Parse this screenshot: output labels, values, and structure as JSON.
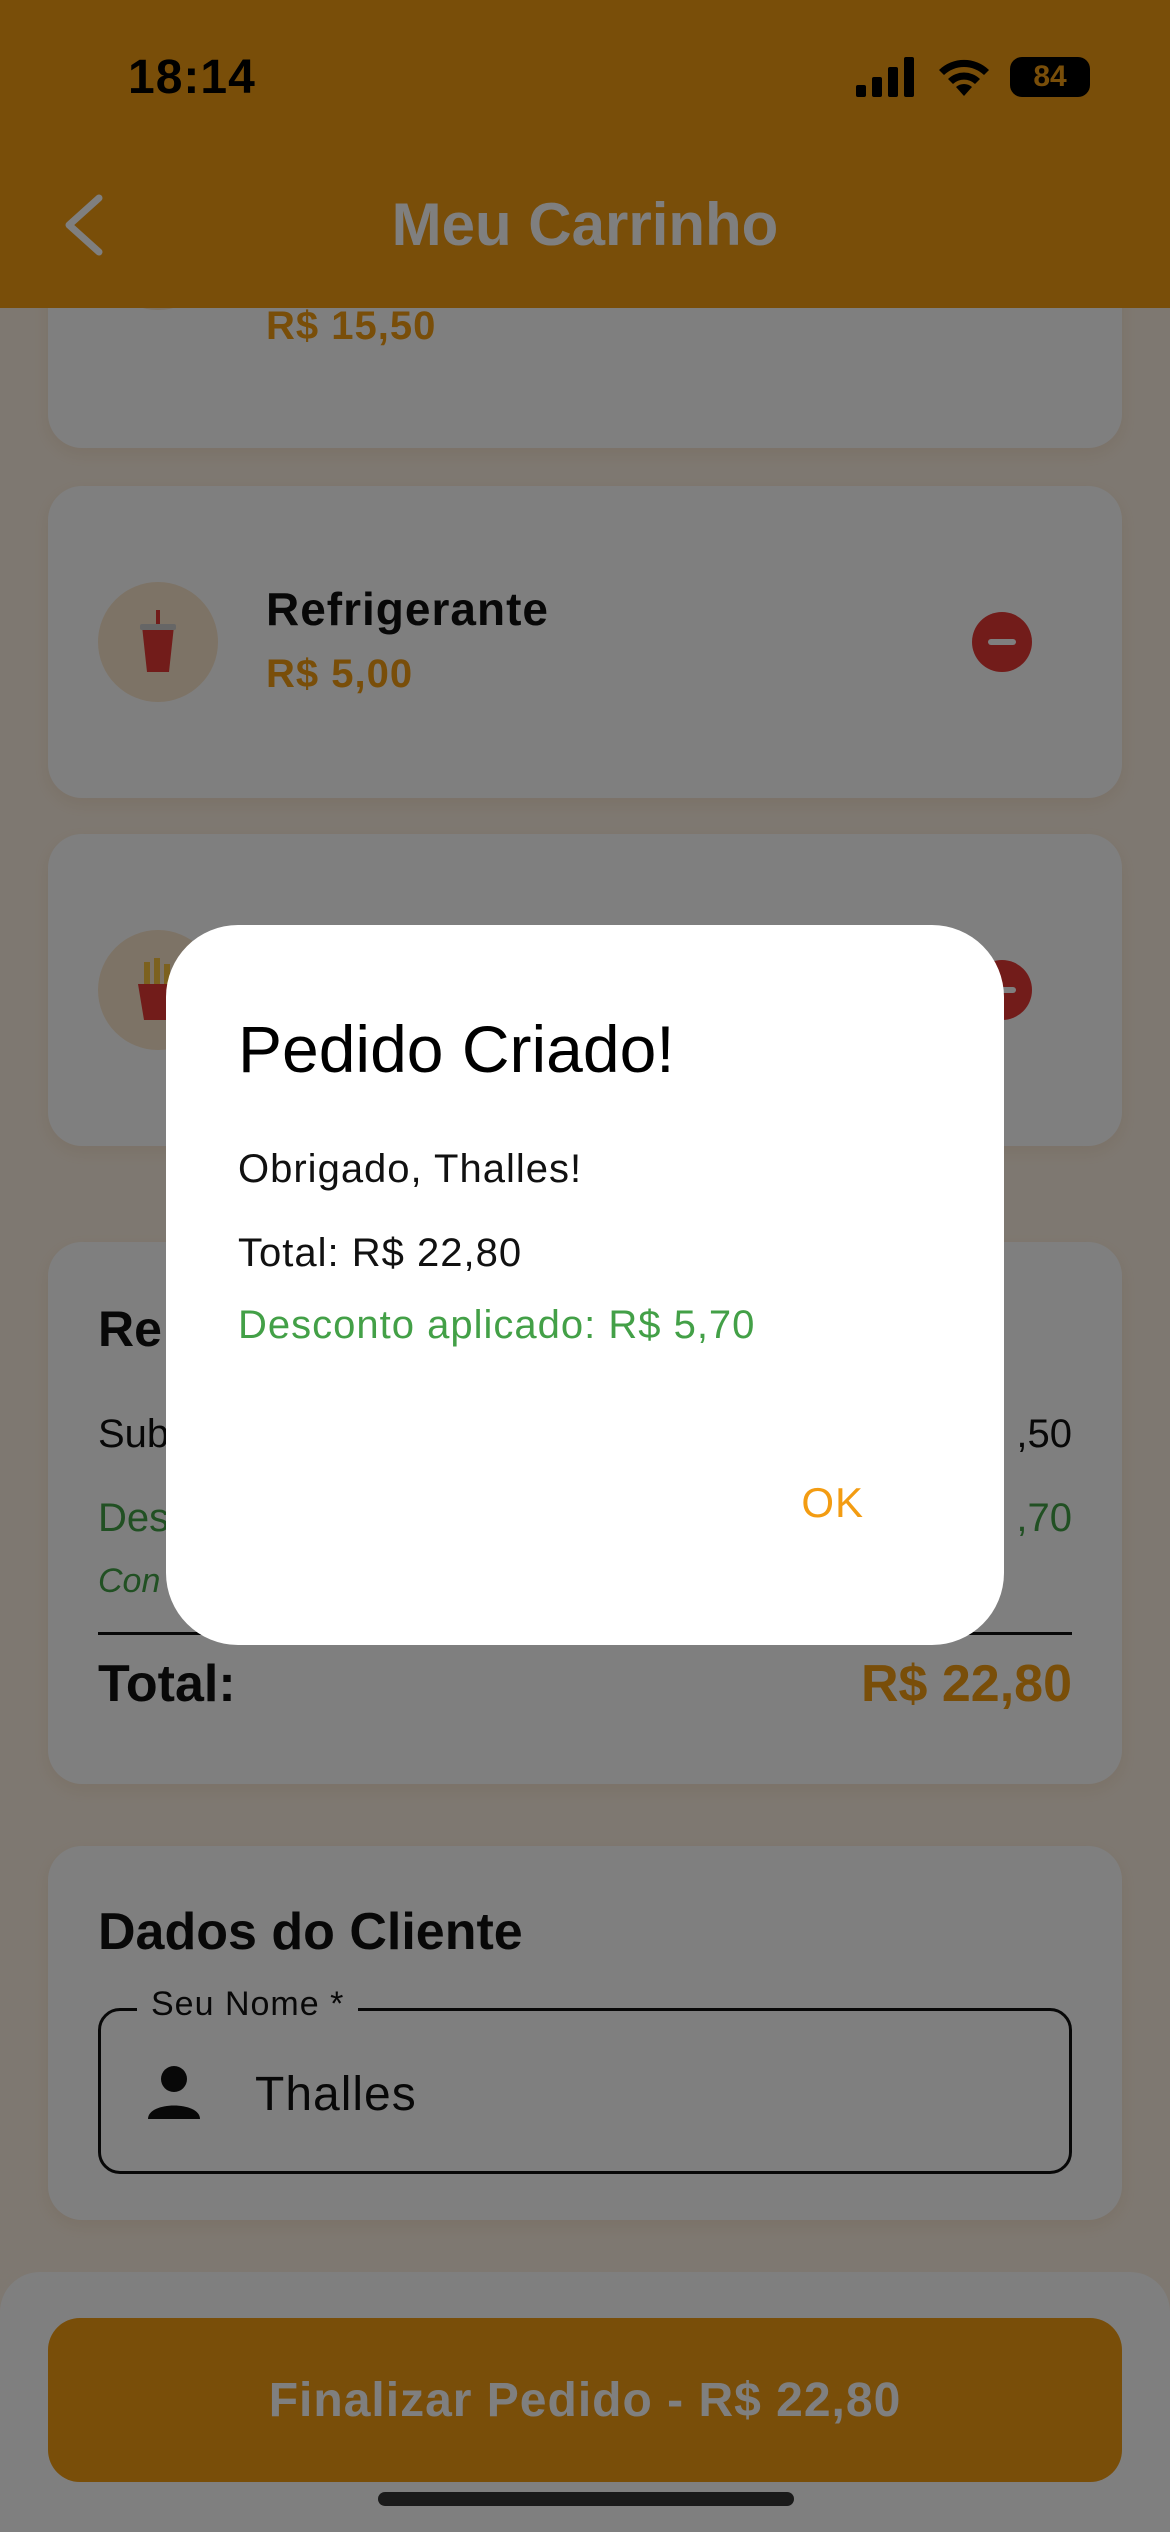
{
  "status_bar": {
    "time": "18:14",
    "battery": "84"
  },
  "header": {
    "title": "Meu Carrinho"
  },
  "cart_items": [
    {
      "name": "",
      "price": "R$ 15,50",
      "icon": "burger-icon"
    },
    {
      "name": "Refrigerante",
      "price": "R$ 5,00",
      "icon": "soda-cup-icon"
    },
    {
      "name": "",
      "price": "",
      "icon": "fries-icon"
    }
  ],
  "summary": {
    "title_visible": "Re",
    "subtotal_label_visible": "Sub",
    "subtotal_value_visible": ",50",
    "discount_label_visible": "Des",
    "discount_value_visible": ",70",
    "note_visible": "Con",
    "total_label": "Total:",
    "total_value": "R$ 22,80"
  },
  "client": {
    "title": "Dados do Cliente",
    "name_label": "Seu Nome *",
    "name_value": "Thalles"
  },
  "checkout_button": "Finalizar Pedido - R$ 22,80",
  "dialog": {
    "title": "Pedido Criado!",
    "thanks": "Obrigado, Thalles!",
    "total": "Total: R$ 22,80",
    "discount": "Desconto aplicado: R$ 5,70",
    "ok_label": "OK"
  },
  "colors": {
    "primary": "#f39c12",
    "danger": "#e53935",
    "success": "#43a047",
    "background": "#fdf1e3"
  }
}
